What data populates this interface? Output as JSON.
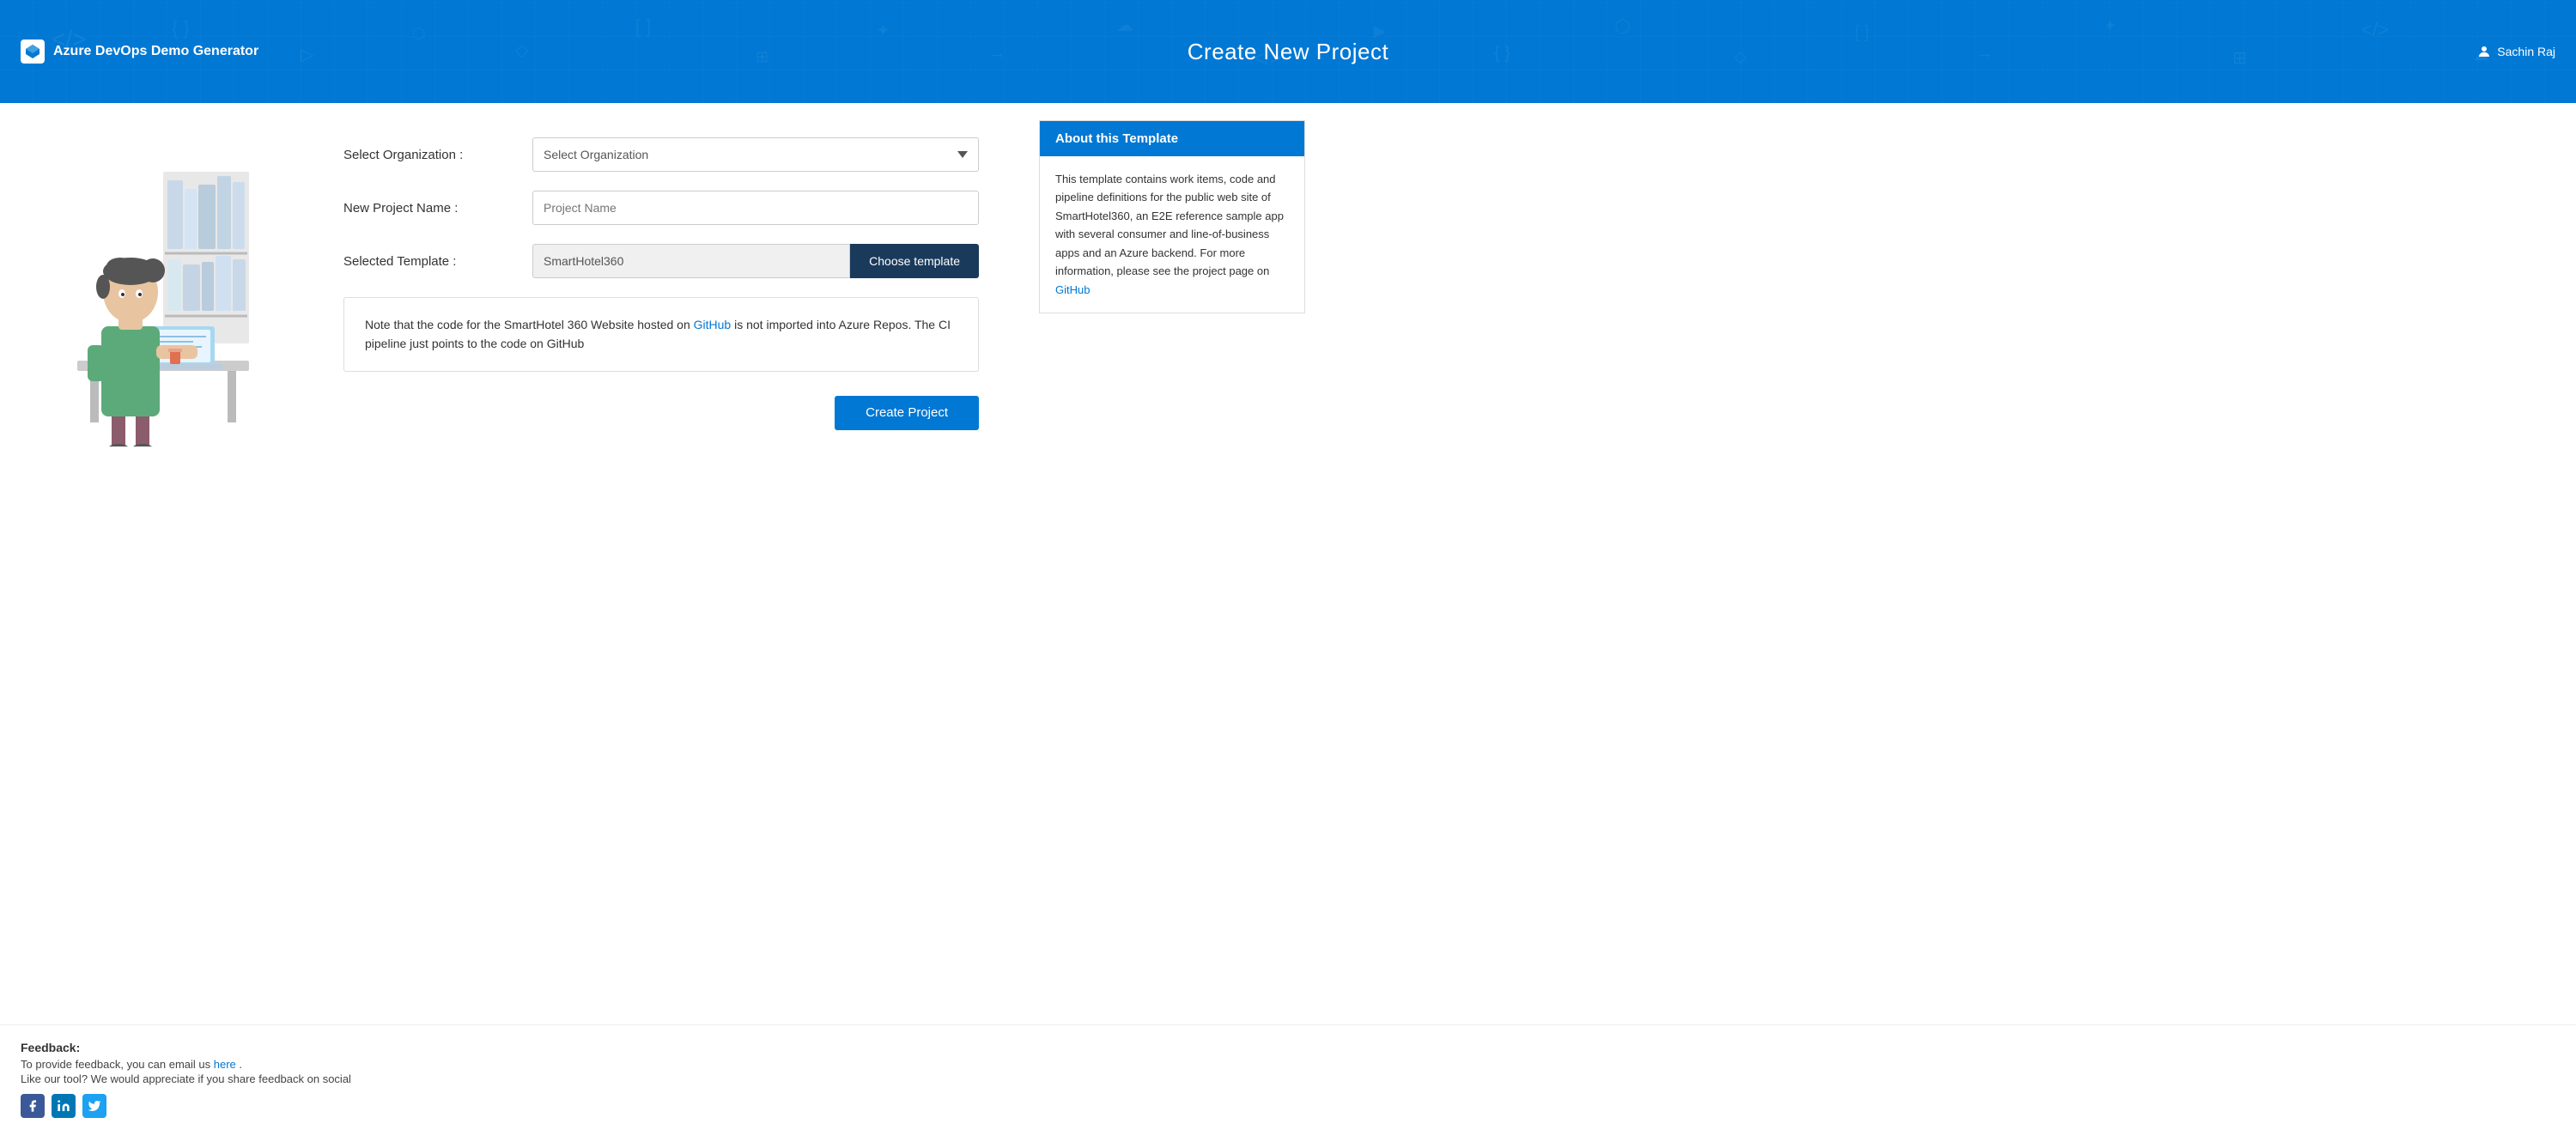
{
  "app": {
    "title": "Azure DevOps Demo Generator",
    "header_title": "Create New Project",
    "user_name": "Sachin Raj"
  },
  "form": {
    "org_label": "Select Organization :",
    "org_placeholder": "Select Organization",
    "org_options": [
      "Select Organization"
    ],
    "project_label": "New Project Name :",
    "project_placeholder": "Project Name",
    "template_label": "Selected Template :",
    "template_value": "SmartHotel360",
    "choose_template_btn": "Choose template",
    "note_text_1": "Note that the code for the SmartHotel 360 Website hosted on ",
    "note_github_link": "GitHub",
    "note_text_2": " is not imported into Azure Repos. The CI pipeline just points to the code on GitHub",
    "create_btn": "Create Project"
  },
  "about": {
    "header": "About this Template",
    "body_text": "This template contains work items, code and pipeline definitions for the public web site of SmartHotel360, an E2E reference sample app with several consumer and line-of-business apps and an Azure backend. For more information, please see the project page on ",
    "github_link": "GitHub"
  },
  "footer": {
    "feedback_title": "Feedback:",
    "feedback_line1": "To provide feedback, you can email us ",
    "feedback_here": "here",
    "feedback_line2": " .",
    "feedback_line3": "Like our tool? We would appreciate if you share feedback on social"
  },
  "social": [
    {
      "name": "facebook",
      "class": "social-facebook"
    },
    {
      "name": "linkedin",
      "class": "social-linkedin"
    },
    {
      "name": "twitter",
      "class": "social-twitter"
    }
  ]
}
